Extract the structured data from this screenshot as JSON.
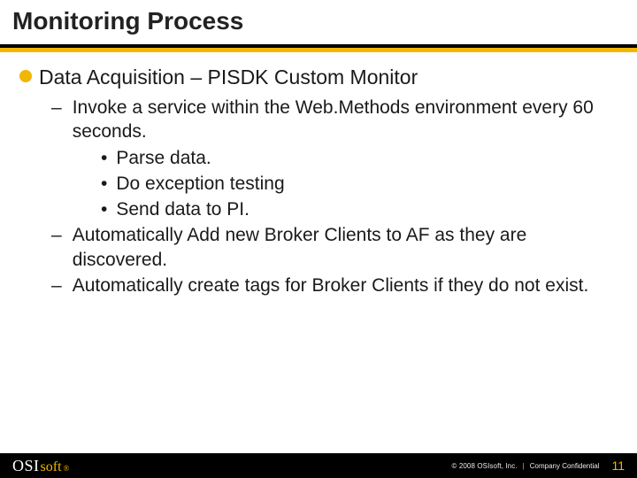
{
  "title": "Monitoring Process",
  "bullets": {
    "lvl1_0": "Data Acquisition – PISDK Custom Monitor",
    "lvl2_0": "Invoke a service within the Web.Methods environment every 60 seconds.",
    "lvl3_0": "Parse data.",
    "lvl3_1": "Do exception testing",
    "lvl3_2": "Send data to PI.",
    "lvl2_1": "Automatically Add new Broker Clients to AF as they are discovered.",
    "lvl2_2": "Automatically create tags for Broker Clients if they do not exist."
  },
  "footer": {
    "logo_osi": "OSI",
    "logo_soft": "soft",
    "logo_mark": "®",
    "copyright": "© 2008 OSIsoft, Inc.",
    "pipe": "|",
    "confidential": "Company Confidential",
    "page": "11"
  }
}
